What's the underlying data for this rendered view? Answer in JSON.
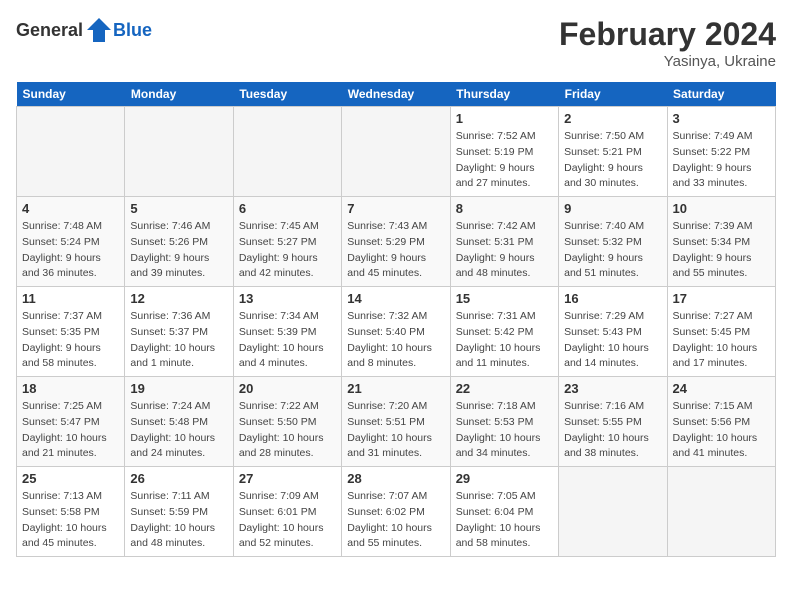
{
  "header": {
    "logo_general": "General",
    "logo_blue": "Blue",
    "month_year": "February 2024",
    "location": "Yasinya, Ukraine"
  },
  "weekdays": [
    "Sunday",
    "Monday",
    "Tuesday",
    "Wednesday",
    "Thursday",
    "Friday",
    "Saturday"
  ],
  "weeks": [
    [
      {
        "day": "",
        "info": ""
      },
      {
        "day": "",
        "info": ""
      },
      {
        "day": "",
        "info": ""
      },
      {
        "day": "",
        "info": ""
      },
      {
        "day": "1",
        "sunrise": "7:52 AM",
        "sunset": "5:19 PM",
        "daylight": "9 hours and 27 minutes."
      },
      {
        "day": "2",
        "sunrise": "7:50 AM",
        "sunset": "5:21 PM",
        "daylight": "9 hours and 30 minutes."
      },
      {
        "day": "3",
        "sunrise": "7:49 AM",
        "sunset": "5:22 PM",
        "daylight": "9 hours and 33 minutes."
      }
    ],
    [
      {
        "day": "4",
        "sunrise": "7:48 AM",
        "sunset": "5:24 PM",
        "daylight": "9 hours and 36 minutes."
      },
      {
        "day": "5",
        "sunrise": "7:46 AM",
        "sunset": "5:26 PM",
        "daylight": "9 hours and 39 minutes."
      },
      {
        "day": "6",
        "sunrise": "7:45 AM",
        "sunset": "5:27 PM",
        "daylight": "9 hours and 42 minutes."
      },
      {
        "day": "7",
        "sunrise": "7:43 AM",
        "sunset": "5:29 PM",
        "daylight": "9 hours and 45 minutes."
      },
      {
        "day": "8",
        "sunrise": "7:42 AM",
        "sunset": "5:31 PM",
        "daylight": "9 hours and 48 minutes."
      },
      {
        "day": "9",
        "sunrise": "7:40 AM",
        "sunset": "5:32 PM",
        "daylight": "9 hours and 51 minutes."
      },
      {
        "day": "10",
        "sunrise": "7:39 AM",
        "sunset": "5:34 PM",
        "daylight": "9 hours and 55 minutes."
      }
    ],
    [
      {
        "day": "11",
        "sunrise": "7:37 AM",
        "sunset": "5:35 PM",
        "daylight": "9 hours and 58 minutes."
      },
      {
        "day": "12",
        "sunrise": "7:36 AM",
        "sunset": "5:37 PM",
        "daylight": "10 hours and 1 minute."
      },
      {
        "day": "13",
        "sunrise": "7:34 AM",
        "sunset": "5:39 PM",
        "daylight": "10 hours and 4 minutes."
      },
      {
        "day": "14",
        "sunrise": "7:32 AM",
        "sunset": "5:40 PM",
        "daylight": "10 hours and 8 minutes."
      },
      {
        "day": "15",
        "sunrise": "7:31 AM",
        "sunset": "5:42 PM",
        "daylight": "10 hours and 11 minutes."
      },
      {
        "day": "16",
        "sunrise": "7:29 AM",
        "sunset": "5:43 PM",
        "daylight": "10 hours and 14 minutes."
      },
      {
        "day": "17",
        "sunrise": "7:27 AM",
        "sunset": "5:45 PM",
        "daylight": "10 hours and 17 minutes."
      }
    ],
    [
      {
        "day": "18",
        "sunrise": "7:25 AM",
        "sunset": "5:47 PM",
        "daylight": "10 hours and 21 minutes."
      },
      {
        "day": "19",
        "sunrise": "7:24 AM",
        "sunset": "5:48 PM",
        "daylight": "10 hours and 24 minutes."
      },
      {
        "day": "20",
        "sunrise": "7:22 AM",
        "sunset": "5:50 PM",
        "daylight": "10 hours and 28 minutes."
      },
      {
        "day": "21",
        "sunrise": "7:20 AM",
        "sunset": "5:51 PM",
        "daylight": "10 hours and 31 minutes."
      },
      {
        "day": "22",
        "sunrise": "7:18 AM",
        "sunset": "5:53 PM",
        "daylight": "10 hours and 34 minutes."
      },
      {
        "day": "23",
        "sunrise": "7:16 AM",
        "sunset": "5:55 PM",
        "daylight": "10 hours and 38 minutes."
      },
      {
        "day": "24",
        "sunrise": "7:15 AM",
        "sunset": "5:56 PM",
        "daylight": "10 hours and 41 minutes."
      }
    ],
    [
      {
        "day": "25",
        "sunrise": "7:13 AM",
        "sunset": "5:58 PM",
        "daylight": "10 hours and 45 minutes."
      },
      {
        "day": "26",
        "sunrise": "7:11 AM",
        "sunset": "5:59 PM",
        "daylight": "10 hours and 48 minutes."
      },
      {
        "day": "27",
        "sunrise": "7:09 AM",
        "sunset": "6:01 PM",
        "daylight": "10 hours and 52 minutes."
      },
      {
        "day": "28",
        "sunrise": "7:07 AM",
        "sunset": "6:02 PM",
        "daylight": "10 hours and 55 minutes."
      },
      {
        "day": "29",
        "sunrise": "7:05 AM",
        "sunset": "6:04 PM",
        "daylight": "10 hours and 58 minutes."
      },
      {
        "day": "",
        "info": ""
      },
      {
        "day": "",
        "info": ""
      }
    ]
  ]
}
